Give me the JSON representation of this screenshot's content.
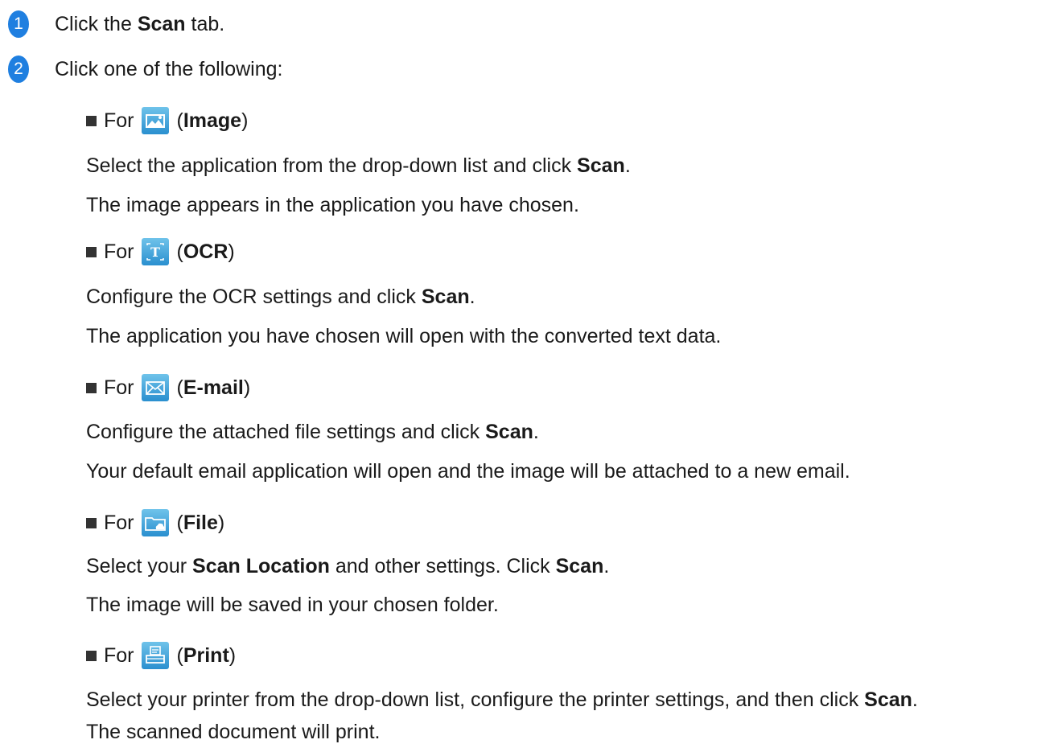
{
  "steps": [
    {
      "number": "1",
      "pre": "Click the ",
      "bold": "Scan",
      "post": " tab."
    },
    {
      "number": "2",
      "text": "Click one of the following:"
    }
  ],
  "options": [
    {
      "for_label": "For",
      "icon": "image-icon",
      "open": "(",
      "name": "Image",
      "close": ")",
      "line1": {
        "pre": "Select the application from the drop-down list and click ",
        "bold": "Scan",
        "post": "."
      },
      "line2": "The image appears in the application you have chosen."
    },
    {
      "for_label": "For",
      "icon": "ocr-icon",
      "open": "(",
      "name": "OCR",
      "close": ")",
      "line1": {
        "pre": "Configure the OCR settings and click ",
        "bold": "Scan",
        "post": "."
      },
      "line2": "The application you have chosen will open with the converted text data."
    },
    {
      "for_label": "For",
      "icon": "email-icon",
      "open": "(",
      "name": "E-mail",
      "close": ")",
      "line1": {
        "pre": "Configure the attached file settings and click ",
        "bold": "Scan",
        "post": "."
      },
      "line2": "Your default email application will open and the image will be attached to a new email."
    },
    {
      "for_label": "For",
      "icon": "file-folder-icon",
      "open": "(",
      "name": "File",
      "close": ")",
      "line1": {
        "pre": "Select your ",
        "bold1": "Scan Location",
        "mid": " and other settings. Click ",
        "bold": "Scan",
        "post": "."
      },
      "line2": "The image will be saved in your chosen folder."
    },
    {
      "for_label": "For",
      "icon": "print-icon",
      "open": "(",
      "name": "Print",
      "close": ")",
      "line1": {
        "pre": "Select your printer from the drop-down list, configure the printer settings, and then click ",
        "bold": "Scan",
        "post": "."
      },
      "line2": "The scanned document will print."
    }
  ],
  "colors": {
    "step_badge": "#1f7fe0",
    "icon_top": "#6fc3ea",
    "icon_bottom": "#2a8fcf",
    "text": "#1a1a1a"
  }
}
